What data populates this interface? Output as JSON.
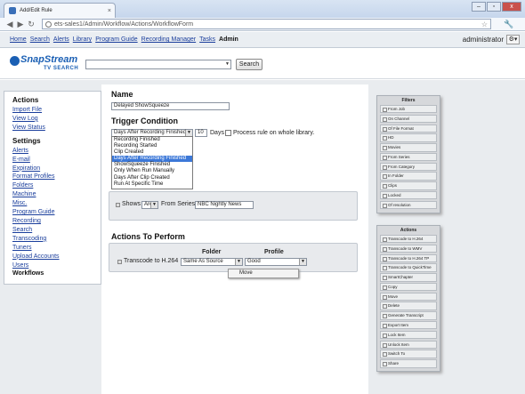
{
  "browser": {
    "tab_title": "Add/Edit Rule",
    "tab_close": "×",
    "url": "ets-sales1/Admin/Workflow/Actions/WorkflowForm",
    "star": "☆",
    "back": "◀",
    "forward": "▶",
    "reload": "↻",
    "wrench": "🔧",
    "win_min": "–",
    "win_max": "▫",
    "win_close": "x"
  },
  "appmenu": {
    "items": [
      "Home",
      "Search",
      "Alerts",
      "Library",
      "Program Guide",
      "Recording Manager",
      "Tasks"
    ],
    "current": "Admin",
    "user": "administrator",
    "gear": "⚙▾"
  },
  "logo": {
    "name": "SnapStream",
    "sub": "TV SEARCH"
  },
  "search": {
    "button": "Search",
    "caret": "▼"
  },
  "sidebar": {
    "actions_head": "Actions",
    "actions": [
      "Import File",
      "View Log",
      "View Status"
    ],
    "settings_head": "Settings",
    "settings": [
      "Alerts",
      "E-mail",
      "Expiration",
      "Format Profiles",
      "Folders",
      "Machine",
      "Misc.",
      "Program Guide",
      "Recording",
      "Search",
      "Transcoding",
      "Tuners",
      "Upload Accounts",
      "Users"
    ],
    "current": "Workflows"
  },
  "form": {
    "name_head": "Name",
    "name_value": "Delayed ShowSqueeze",
    "trigger_head": "Trigger Condition",
    "trigger_selected": "Days After Recording Finished",
    "days_value": "10",
    "days_label": "Days",
    "process_label": "Process rule on whole library.",
    "trigger_options": [
      "Recording Finished",
      "Recording Started",
      "Clip Created",
      "Days After Recording Finished",
      "ShowSqueeze Finished",
      "Only When Run Manually",
      "Days After Clip Created",
      "Run At Specific Time"
    ],
    "trigger_highlight_index": 3,
    "filter_shows": "Shows",
    "filter_op": "Are",
    "filter_from": "From Series",
    "filter_value": "NBC Nightly News",
    "actions_head": "Actions To Perform",
    "col_folder": "Folder",
    "col_profile": "Profile",
    "action_name": "Transcode to H.264",
    "action_folder": "Same As Source",
    "action_profile": "Good",
    "context_item": "Move",
    "caret": "▼"
  },
  "filters_box": {
    "title": "Filters",
    "items": [
      "From Job",
      "On Channel",
      "Of File Format",
      "HD",
      "Movies",
      "From Series",
      "From Category",
      "In Folder",
      "Clips",
      "Locked",
      "Of resolution"
    ]
  },
  "actions_box": {
    "title": "Actions",
    "items": [
      "Transcode to H.264",
      "Transcode to WMV",
      "Transcode to H.264 TP",
      "Transcode to QuickTime",
      "SmartChapter",
      "Copy",
      "Move",
      "Delete",
      "Generate Transcript",
      "Export Item",
      "Lock Item",
      "Unlock Item",
      "Switch To",
      "Share"
    ]
  }
}
